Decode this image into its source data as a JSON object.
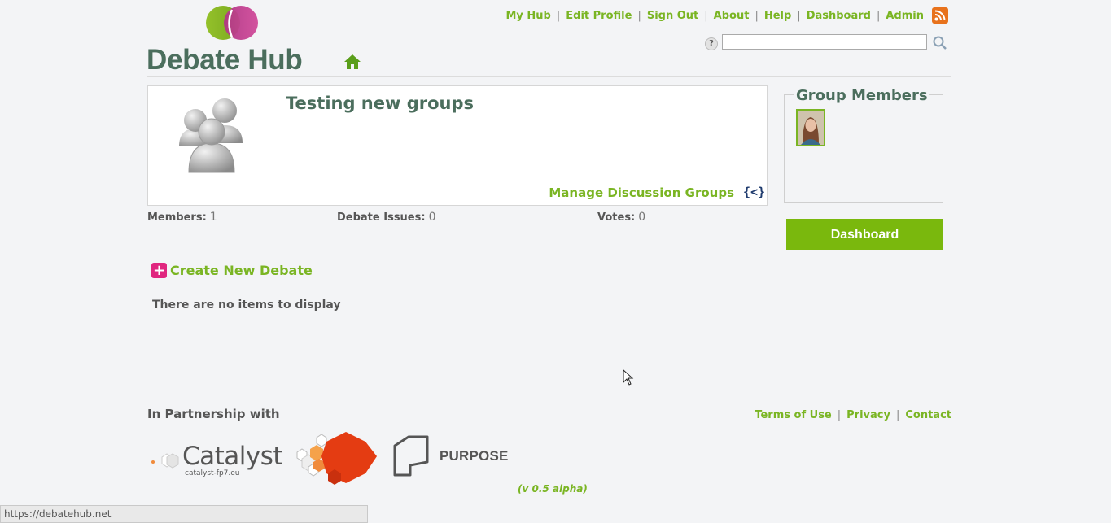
{
  "brand": {
    "name": "Debate Hub"
  },
  "top_nav": {
    "items": [
      "My Hub",
      "Edit Profile",
      "Sign Out",
      "About",
      "Help",
      "Dashboard",
      "Admin"
    ]
  },
  "search": {
    "help_label": "?",
    "value": ""
  },
  "group": {
    "title": "Testing new groups",
    "manage_label": "Manage Discussion Groups",
    "embed_label": "{<}"
  },
  "stats": {
    "members_label": "Members:",
    "members_value": "1",
    "issues_label": "Debate Issues:",
    "issues_value": "0",
    "votes_label": "Votes:",
    "votes_value": "0"
  },
  "create_debate": {
    "label": "Create New Debate"
  },
  "empty_message": "There are no items to display",
  "sidebar": {
    "members_title": "Group Members",
    "dashboard_label": "Dashboard"
  },
  "footer": {
    "partnership": "In Partnership with",
    "links": [
      "Terms of Use",
      "Privacy",
      "Contact"
    ],
    "catalyst_name": "Catalyst",
    "catalyst_url": "catalyst-fp7.eu",
    "purpose_name": "PURPOSE",
    "version": "(v 0.5 alpha)"
  },
  "status_bar": {
    "url": "https://debatehub.net"
  },
  "colors": {
    "accent": "#7ab523",
    "title": "#4b6e5d",
    "create_icon": "#e0267f",
    "rss": "#e8721c"
  }
}
